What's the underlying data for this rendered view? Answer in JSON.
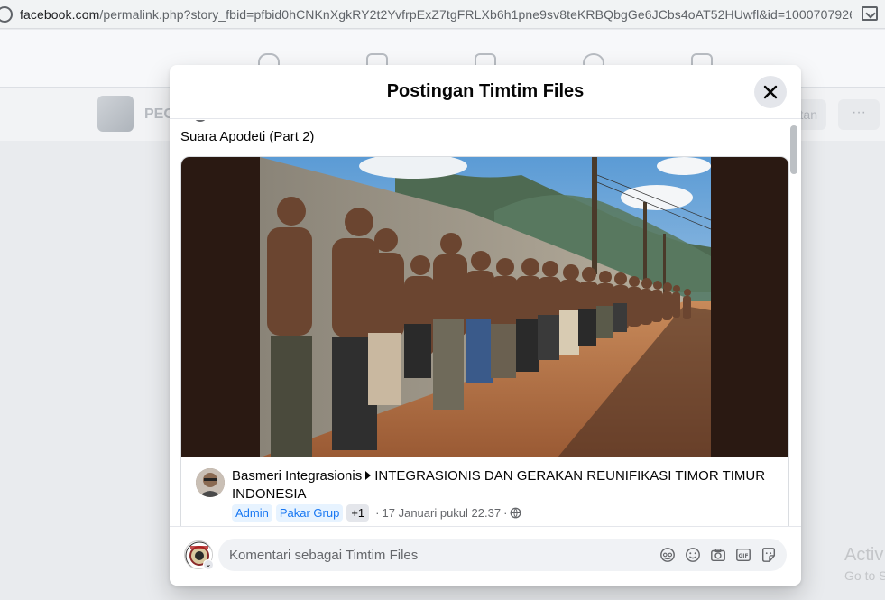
{
  "browser": {
    "url_host": "facebook.com",
    "url_path": "/permalink.php?story_fbid=pfbid0hCNKnXgkRY2t2YvfrpExZ7tgFRLXb6h1pne9sv8teKRBQbgGe6JCbs4oAT52HUwfl&id=100070792676..."
  },
  "background": {
    "group_name": "PEC",
    "right_button_label": "tan",
    "more_label": "···",
    "watermark_title": "Activ",
    "watermark_sub": "Go to S"
  },
  "modal": {
    "title": "Postingan Timtim Files",
    "post_text": "Suara Apodeti (Part 2)",
    "shared": {
      "sharer_name": "Basmeri Integrasionis",
      "group_name": "INTEGRASIONIS DAN GERAKAN REUNIFIKASI TIMOR TIMUR INDONESIA",
      "badge_admin": "Admin",
      "badge_expert": "Pakar Grup",
      "badge_more": "+1",
      "separator": "·",
      "timestamp": "17 Januari pukul 22.37",
      "privacy_icon": "globe-icon"
    },
    "comment": {
      "placeholder": "Komentari sebagai Timtim Files",
      "icons": [
        "avatar-sticker-icon",
        "emoji-icon",
        "camera-icon",
        "gif-icon",
        "sticker-icon"
      ]
    }
  }
}
